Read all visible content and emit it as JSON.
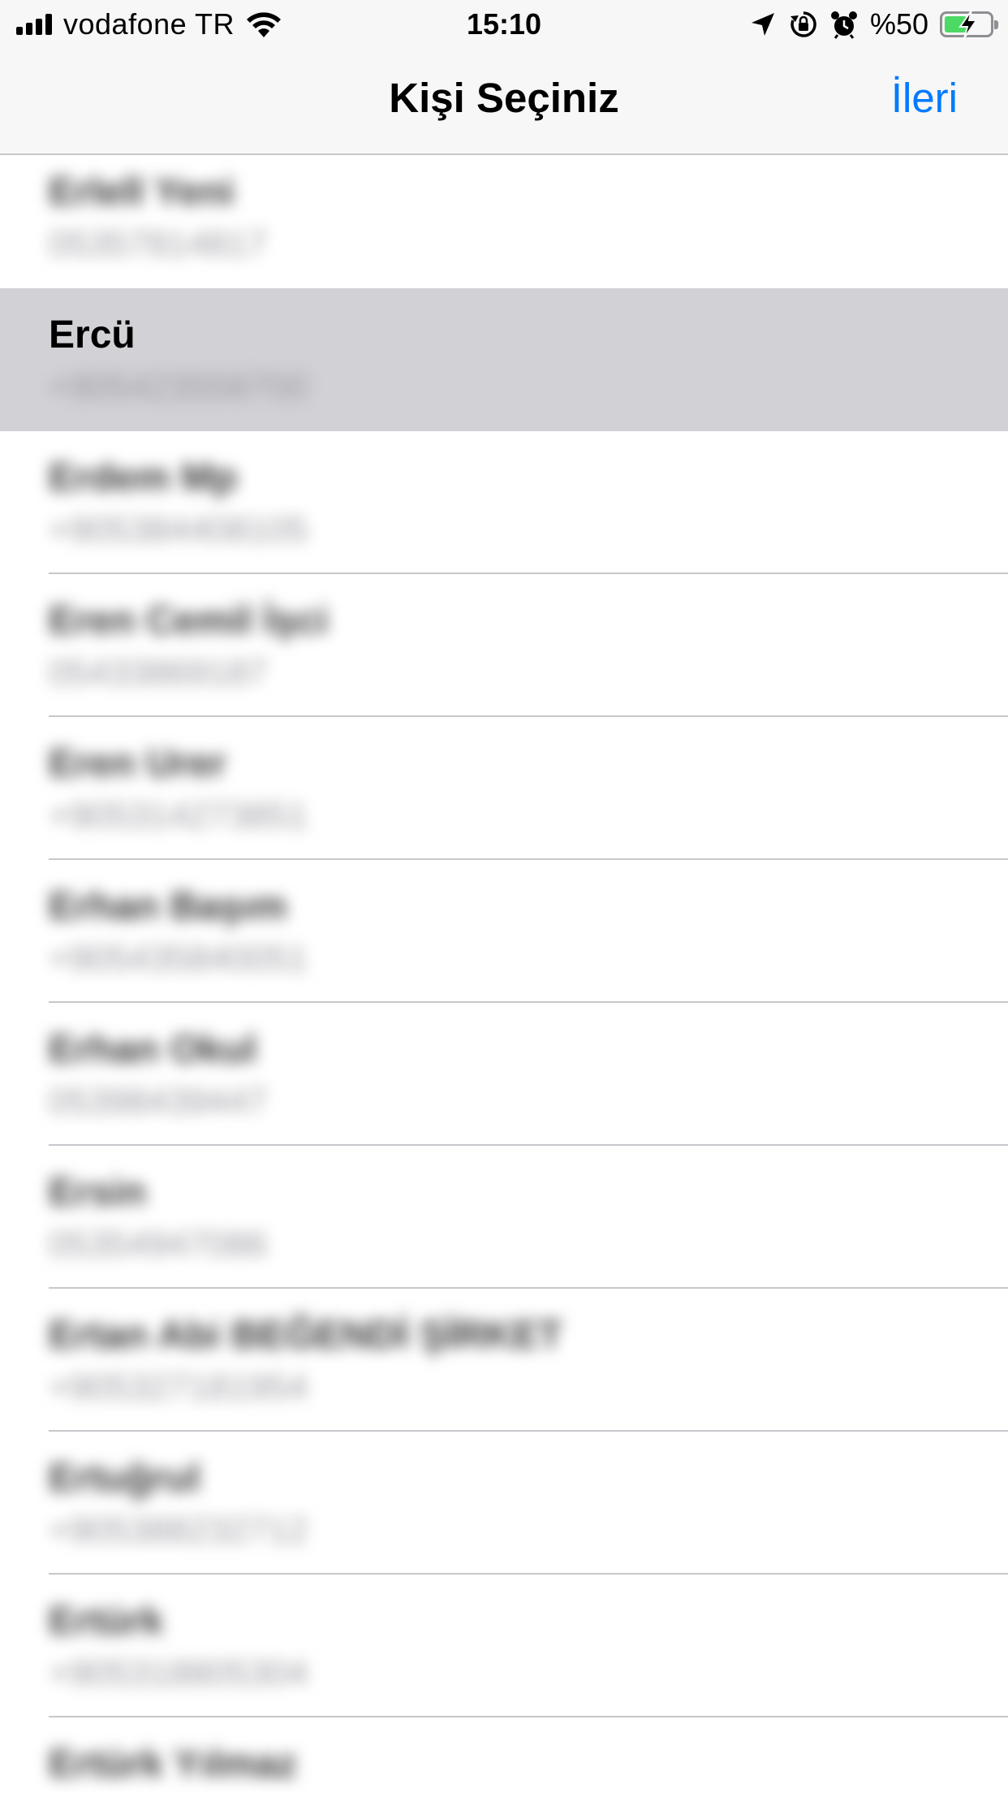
{
  "status_bar": {
    "carrier": "vodafone TR",
    "time": "15:10",
    "battery_percent": "%50",
    "battery_level": 0.5,
    "icons": [
      "signal-icon",
      "wifi-icon",
      "location-arrow-icon",
      "rotation-lock-icon",
      "alarm-icon",
      "battery-icon"
    ]
  },
  "nav": {
    "title": "Kişi Seçiniz",
    "next_label": "İleri",
    "accent_color": "#007aff"
  },
  "contacts": [
    {
      "name": "Erlell Yeni",
      "phone": "05357814817",
      "blurred": true,
      "selected": false
    },
    {
      "name": "Ercü",
      "phone": "+905423558700",
      "blurred": false,
      "phone_blurred": true,
      "selected": true
    },
    {
      "name": "Erdem Mp",
      "phone": "+905384408105",
      "blurred": true,
      "selected": false
    },
    {
      "name": "Eren Cemil İşci",
      "phone": "05433869187",
      "blurred": true,
      "selected": false
    },
    {
      "name": "Eren Urer",
      "phone": "+905314273851",
      "blurred": true,
      "selected": false
    },
    {
      "name": "Erhan Başım",
      "phone": "+905435840051",
      "blurred": true,
      "selected": false
    },
    {
      "name": "Erhan Okul",
      "phone": "05398439447",
      "blurred": true,
      "selected": false
    },
    {
      "name": "Ersin",
      "phone": "05354947086",
      "blurred": true,
      "selected": false
    },
    {
      "name": "Ertan Abi BEĞENDİ ŞİRKET",
      "phone": "+905327181954",
      "blurred": true,
      "selected": false
    },
    {
      "name": "Ertuğrul",
      "phone": "+905388232712",
      "blurred": true,
      "selected": false
    },
    {
      "name": "Ertürk",
      "phone": "+905318805304",
      "blurred": true,
      "selected": false
    },
    {
      "name": "Ertürk Yılmaz",
      "phone": "",
      "blurred": true,
      "selected": false
    }
  ],
  "colors": {
    "selected_row": "#d1d1d6",
    "divider": "#c8c7cc",
    "battery_fill": "#4cd964"
  }
}
